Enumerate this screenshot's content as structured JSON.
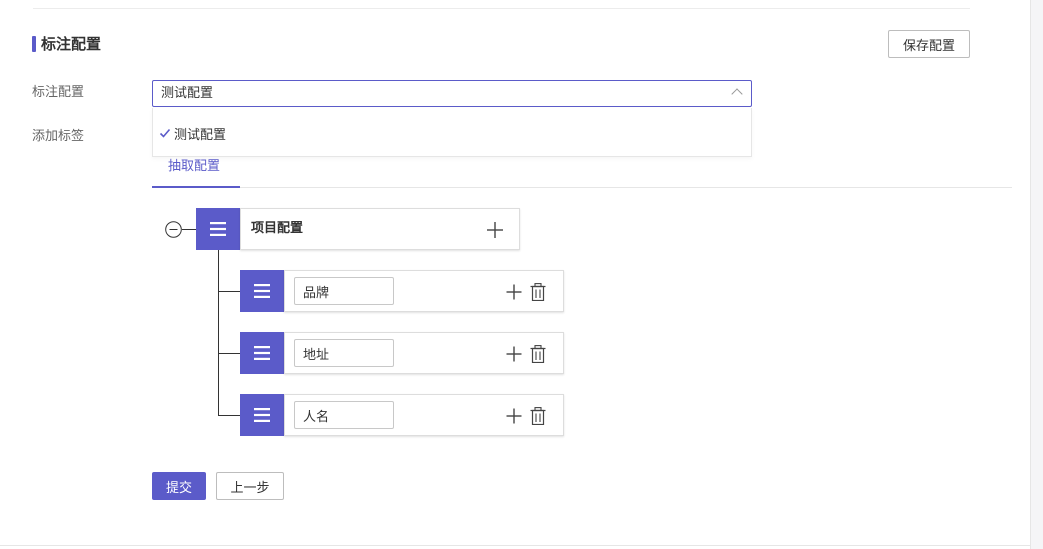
{
  "section": {
    "title": "标注配置",
    "save_label": "保存配置"
  },
  "form": {
    "config_label": "标注配置",
    "add_tag_label": "添加标签",
    "select_value": "测试配置",
    "dropdown_options": [
      "测试配置"
    ]
  },
  "tabs": [
    {
      "label": "抽取配置",
      "active": true
    }
  ],
  "tree": {
    "root": {
      "title": "项目配置"
    },
    "children": [
      {
        "value": "品牌"
      },
      {
        "value": "地址"
      },
      {
        "value": "人名"
      }
    ]
  },
  "actions": {
    "submit_label": "提交",
    "prev_label": "上一步"
  },
  "colors": {
    "accent": "#5b5bc9",
    "border": "#bdbdbd"
  },
  "icons": {
    "collapse": "minus-circle-icon",
    "handle": "hamburger-menu-icon",
    "add": "plus-icon",
    "delete": "trash-icon",
    "check": "check-icon",
    "chevron": "chevron-up-icon"
  }
}
